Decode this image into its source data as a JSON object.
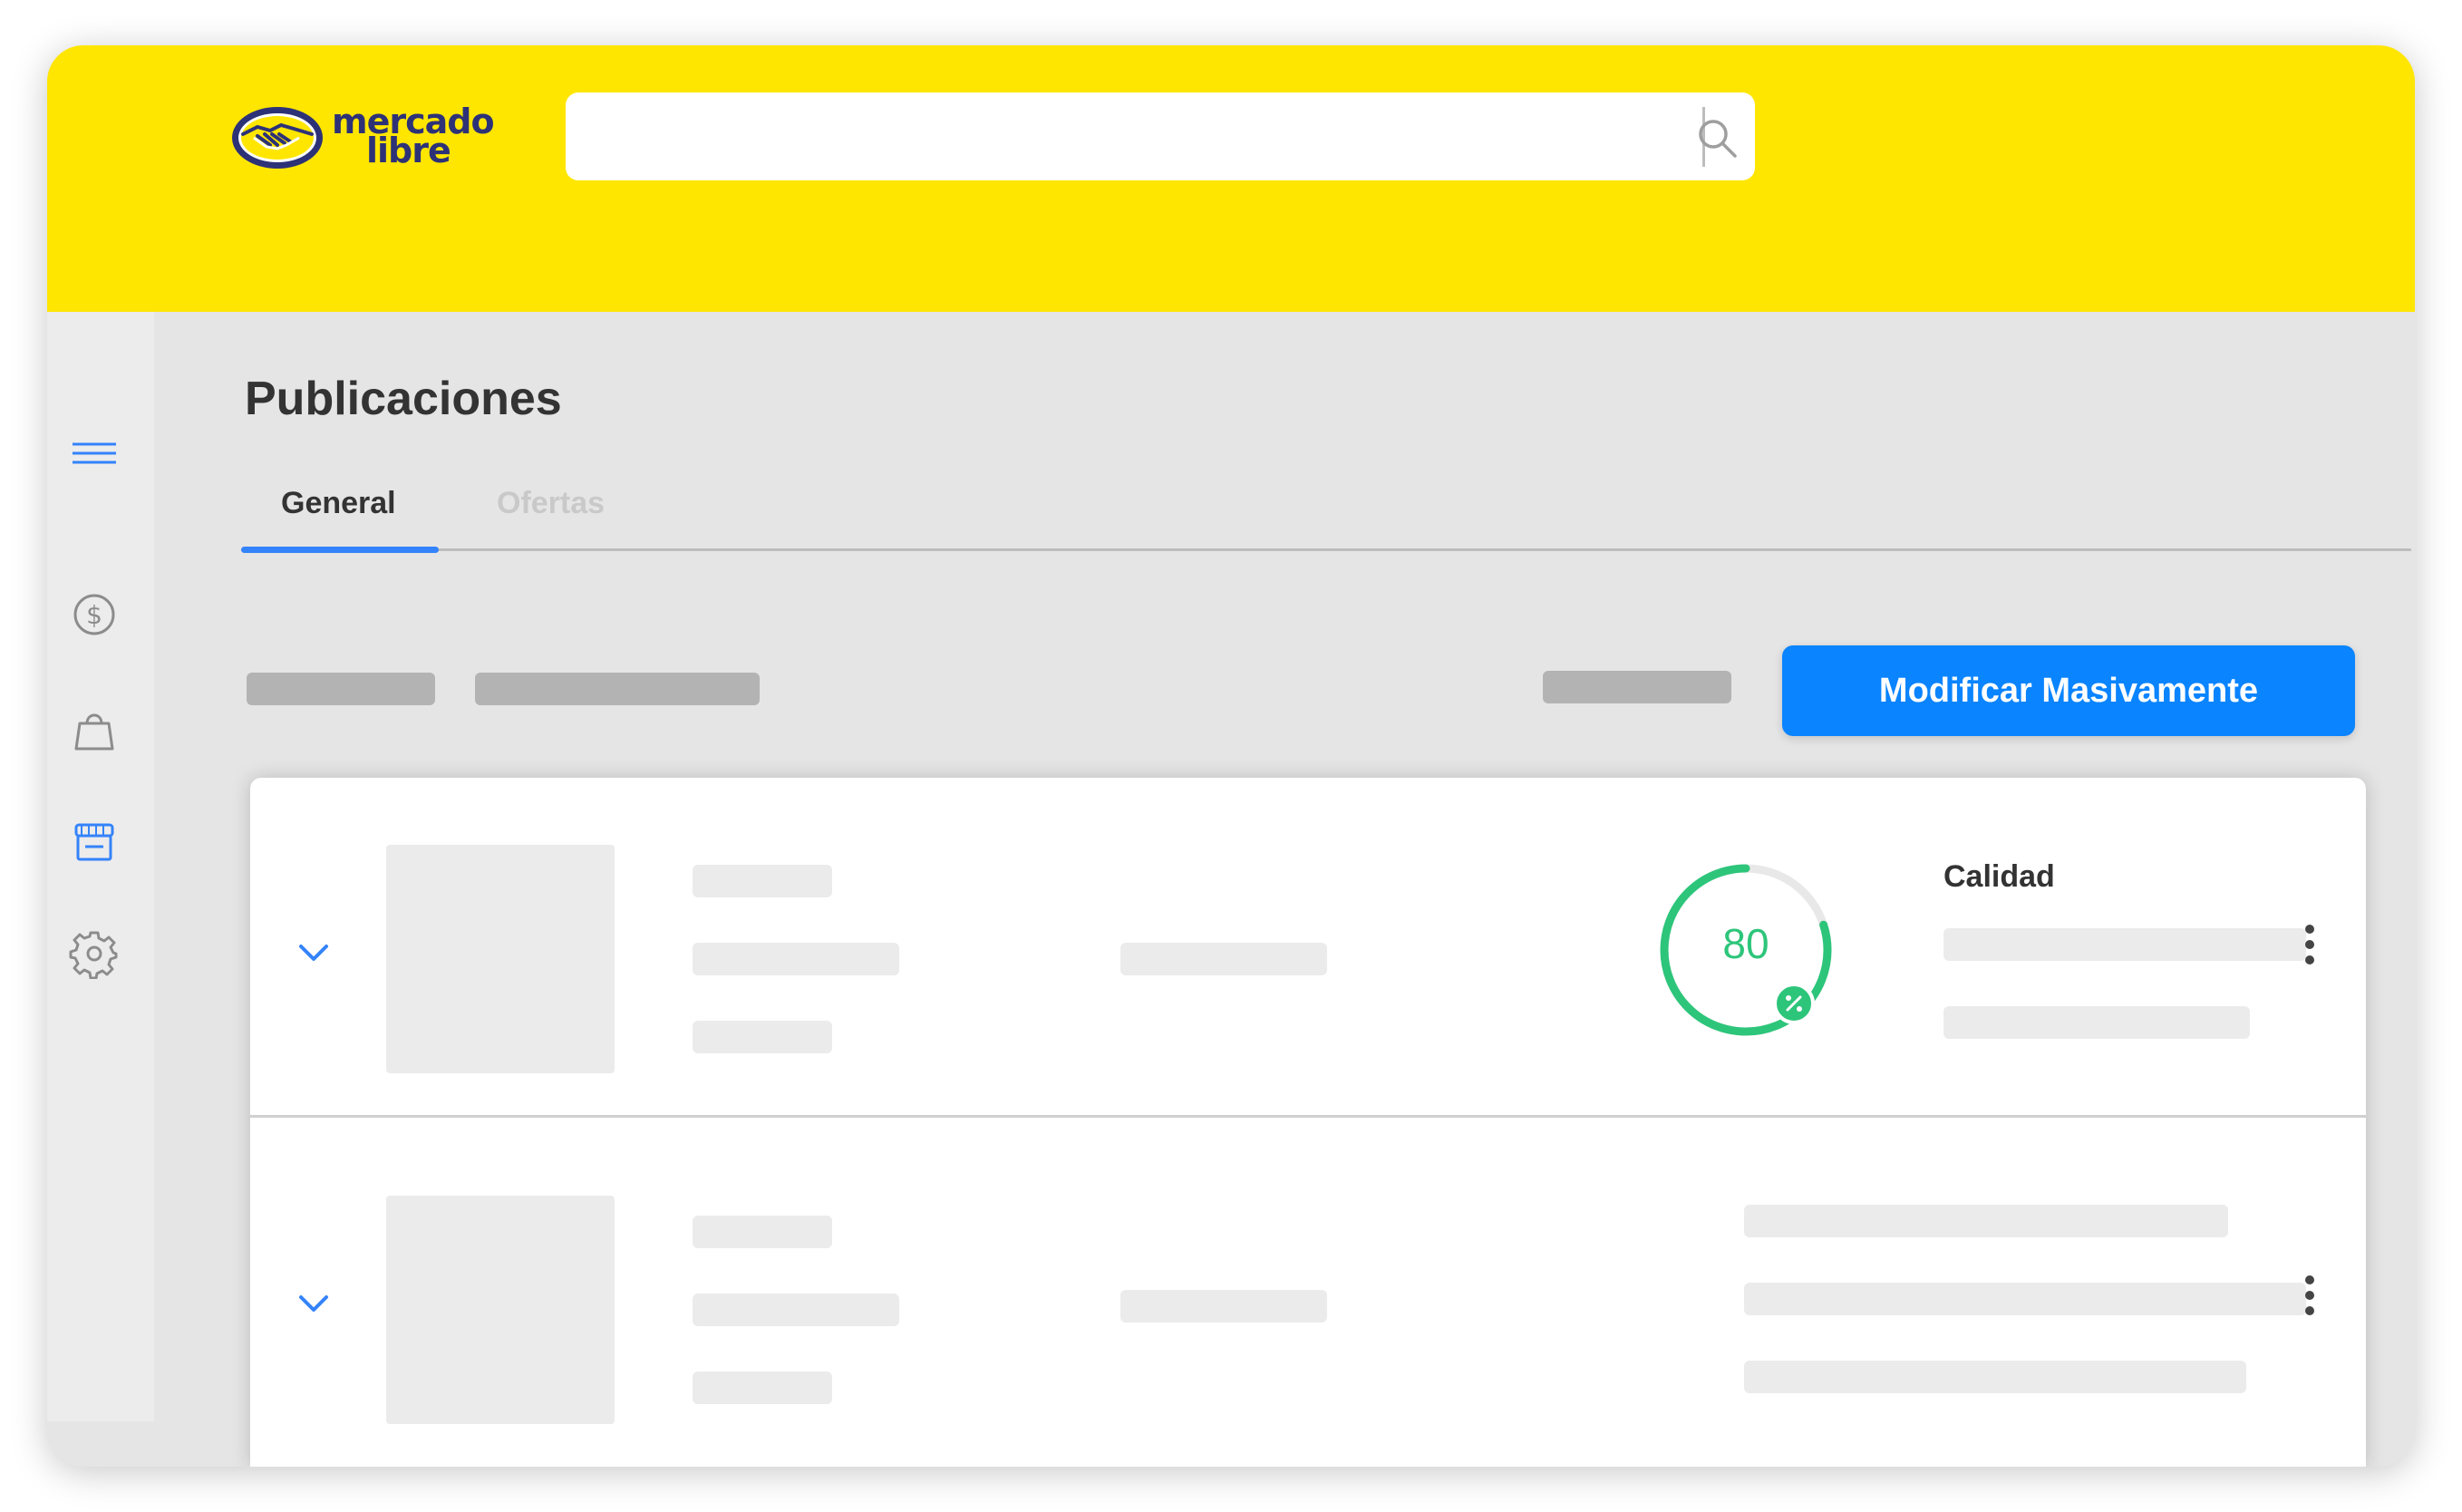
{
  "brand": {
    "logo_line1": "mercado",
    "logo_line2": "libre",
    "colors": {
      "header": "#ffe600",
      "accent": "#3483fa",
      "primary_button": "#0a84ff",
      "quality_good": "#2dc57a",
      "logo_navy": "#2d3277"
    }
  },
  "search": {
    "placeholder": "",
    "value": "",
    "button_icon": "search-icon"
  },
  "sidebar": {
    "items": [
      {
        "icon": "menu-icon"
      },
      {
        "icon": "dollar-circle-icon"
      },
      {
        "icon": "shopping-bag-icon"
      },
      {
        "icon": "store-icon",
        "active": true
      },
      {
        "icon": "gear-icon"
      }
    ]
  },
  "page": {
    "title": "Publicaciones"
  },
  "tabs": [
    {
      "label": "General",
      "active": true
    },
    {
      "label": "Ofertas",
      "active": false
    }
  ],
  "toolbar": {
    "bulk_edit_label": "Modificar Masivamente"
  },
  "listings": [
    {
      "quality_label": "Calidad",
      "quality_score": "80",
      "quality_score_value": 80
    },
    {}
  ]
}
